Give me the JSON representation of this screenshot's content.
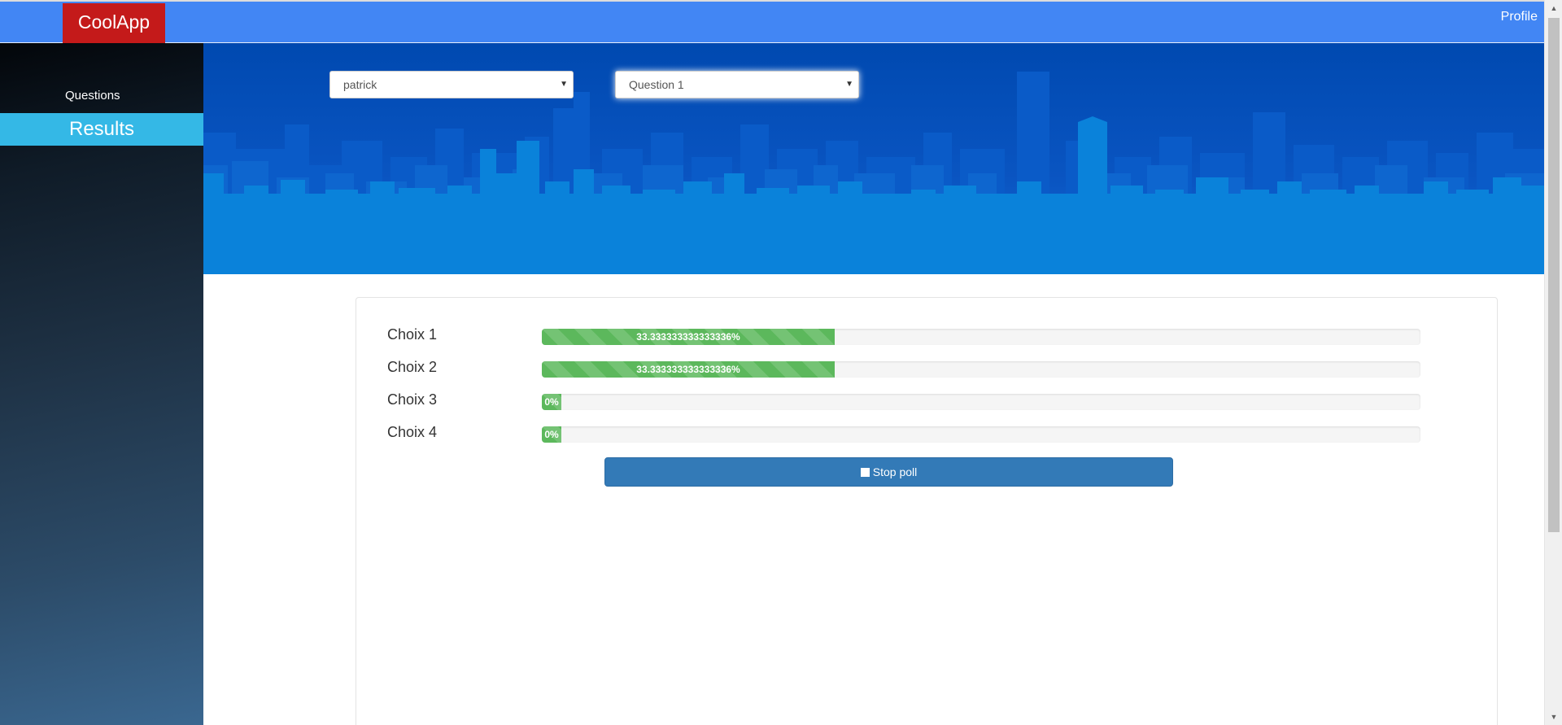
{
  "header": {
    "brand": "CoolApp",
    "profile_label": "Profile",
    "colors": {
      "topbar": "#4286f4",
      "brand": "#c41a1a"
    }
  },
  "sidebar": {
    "items": [
      {
        "label": "Questions",
        "active": false
      },
      {
        "label": "Results",
        "active": true
      }
    ],
    "colors": {
      "active": "#34b8e6"
    }
  },
  "filters": {
    "user_select": {
      "value": "patrick"
    },
    "question_select": {
      "value": "Question 1"
    }
  },
  "results": {
    "choices": [
      {
        "label": "Choix 1",
        "percent_text": "33.333333333333336%",
        "percent": 33.333333333333336
      },
      {
        "label": "Choix 2",
        "percent_text": "33.333333333333336%",
        "percent": 33.333333333333336
      },
      {
        "label": "Choix 3",
        "percent_text": "0%",
        "percent": 0
      },
      {
        "label": "Choix 4",
        "percent_text": "0%",
        "percent": 0
      }
    ],
    "stop_button_label": "Stop poll",
    "colors": {
      "bar": "#5cb85c",
      "button": "#337ab7"
    }
  }
}
